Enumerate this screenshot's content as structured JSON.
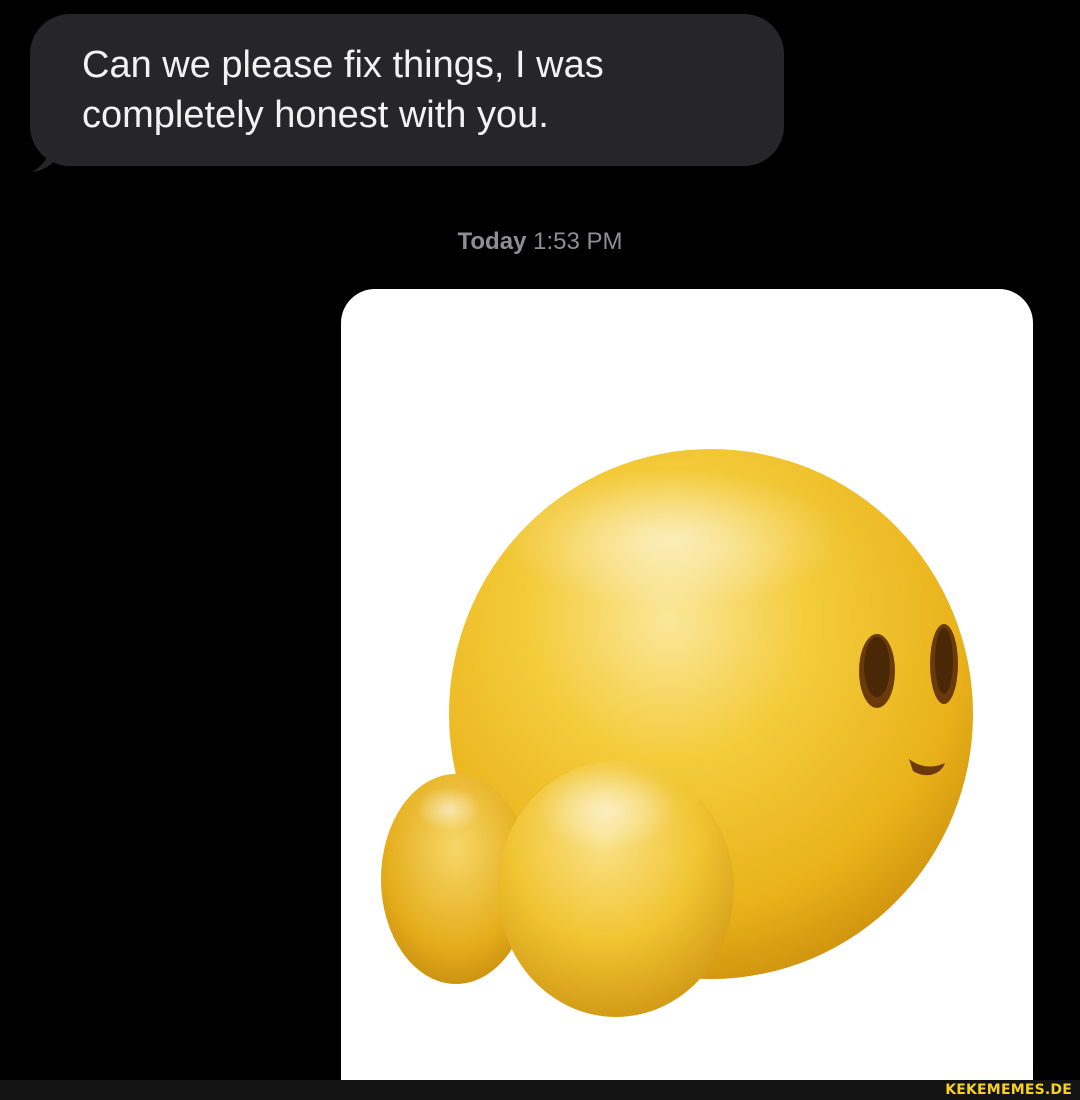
{
  "conversation": {
    "incoming_message": {
      "text": "Can we please fix things, I was completely honest with you."
    },
    "timestamp": {
      "day": "Today",
      "time": "1:53 PM"
    },
    "outgoing_image": {
      "icon": "peach-butt-emoji-icon",
      "colors": {
        "card_background": "#ffffff",
        "emoji_yellow": "#f2c21c",
        "emoji_shadow": "#c78a0c"
      }
    }
  },
  "watermark": {
    "text": "KEKEMEMES.DE"
  },
  "colors": {
    "background": "#000000",
    "incoming_bubble": "#262628",
    "incoming_text": "#f2f2f2",
    "timestamp_text": "#8e8e93",
    "watermark_text": "#f6d21e"
  }
}
